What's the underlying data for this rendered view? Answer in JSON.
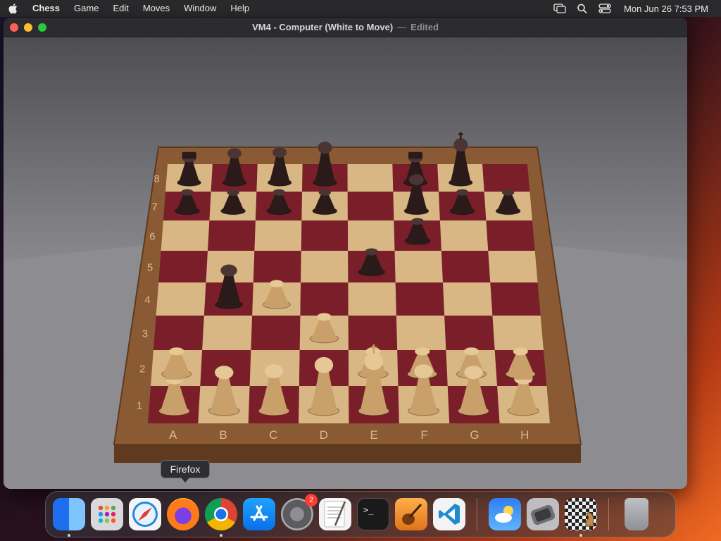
{
  "menubar": {
    "app_name": "Chess",
    "items": [
      "Game",
      "Edit",
      "Moves",
      "Window",
      "Help"
    ],
    "clock": "Mon Jun 26  7:53 PM"
  },
  "window": {
    "title": "VM4 - Computer   (White to Move)",
    "separator": "—",
    "edited": "Edited"
  },
  "board": {
    "rank_labels": [
      "8",
      "7",
      "6",
      "5",
      "4",
      "3",
      "2",
      "1"
    ],
    "file_labels": [
      "A",
      "B",
      "C",
      "D",
      "E",
      "F",
      "G",
      "H"
    ],
    "light_square": "#d9b784",
    "dark_square": "#7a1f2a",
    "frame_color": "#8a5a34",
    "pieces": [
      {
        "color": "black",
        "type": "rook",
        "square": "a8"
      },
      {
        "color": "black",
        "type": "knight",
        "square": "b8"
      },
      {
        "color": "black",
        "type": "bishop",
        "square": "c8"
      },
      {
        "color": "black",
        "type": "queen",
        "square": "d8"
      },
      {
        "color": "black",
        "type": "rook",
        "square": "f8"
      },
      {
        "color": "black",
        "type": "king",
        "square": "g8"
      },
      {
        "color": "black",
        "type": "pawn",
        "square": "a7"
      },
      {
        "color": "black",
        "type": "pawn",
        "square": "b7"
      },
      {
        "color": "black",
        "type": "pawn",
        "square": "c7"
      },
      {
        "color": "black",
        "type": "pawn",
        "square": "d7"
      },
      {
        "color": "black",
        "type": "bishop",
        "square": "f7"
      },
      {
        "color": "black",
        "type": "pawn",
        "square": "g7"
      },
      {
        "color": "black",
        "type": "pawn",
        "square": "h7"
      },
      {
        "color": "black",
        "type": "pawn",
        "square": "f6"
      },
      {
        "color": "black",
        "type": "pawn",
        "square": "e5"
      },
      {
        "color": "black",
        "type": "knight",
        "square": "b4"
      },
      {
        "color": "white",
        "type": "pawn",
        "square": "c4"
      },
      {
        "color": "white",
        "type": "pawn",
        "square": "d3"
      },
      {
        "color": "white",
        "type": "pawn",
        "square": "a2"
      },
      {
        "color": "white",
        "type": "pawn",
        "square": "e2"
      },
      {
        "color": "white",
        "type": "pawn",
        "square": "f2"
      },
      {
        "color": "white",
        "type": "pawn",
        "square": "g2"
      },
      {
        "color": "white",
        "type": "pawn",
        "square": "h2"
      },
      {
        "color": "white",
        "type": "rook",
        "square": "a1"
      },
      {
        "color": "white",
        "type": "knight",
        "square": "b1"
      },
      {
        "color": "white",
        "type": "bishop",
        "square": "c1"
      },
      {
        "color": "white",
        "type": "queen",
        "square": "d1"
      },
      {
        "color": "white",
        "type": "king",
        "square": "e1"
      },
      {
        "color": "white",
        "type": "bishop",
        "square": "f1"
      },
      {
        "color": "white",
        "type": "knight",
        "square": "g1"
      },
      {
        "color": "white",
        "type": "rook",
        "square": "h1"
      }
    ]
  },
  "tooltip": {
    "label": "Firefox"
  },
  "dock": {
    "items": [
      {
        "name": "Finder",
        "icon": "finder-icon",
        "running": true
      },
      {
        "name": "Launchpad",
        "icon": "launchpad-icon",
        "running": false
      },
      {
        "name": "Safari",
        "icon": "safari-icon",
        "running": false
      },
      {
        "name": "Firefox",
        "icon": "firefox-icon",
        "running": false
      },
      {
        "name": "Google Chrome",
        "icon": "chrome-icon",
        "running": true
      },
      {
        "name": "App Store",
        "icon": "app-store-icon",
        "running": false
      },
      {
        "name": "System Settings",
        "icon": "settings-icon",
        "running": false,
        "badge": "2"
      },
      {
        "name": "TextEdit",
        "icon": "textedit-icon",
        "running": false
      },
      {
        "name": "Terminal",
        "icon": "terminal-icon",
        "running": false
      },
      {
        "name": "GarageBand",
        "icon": "garageband-icon",
        "running": false
      },
      {
        "name": "Visual Studio Code",
        "icon": "vscode-icon",
        "running": false
      },
      {
        "name": "Weather",
        "icon": "weather-icon",
        "running": false
      },
      {
        "name": "Simulator",
        "icon": "simulator-icon",
        "running": false
      },
      {
        "name": "Chess",
        "icon": "chess-icon",
        "running": true
      },
      {
        "name": "Trash",
        "icon": "trash-icon",
        "running": false
      }
    ]
  }
}
